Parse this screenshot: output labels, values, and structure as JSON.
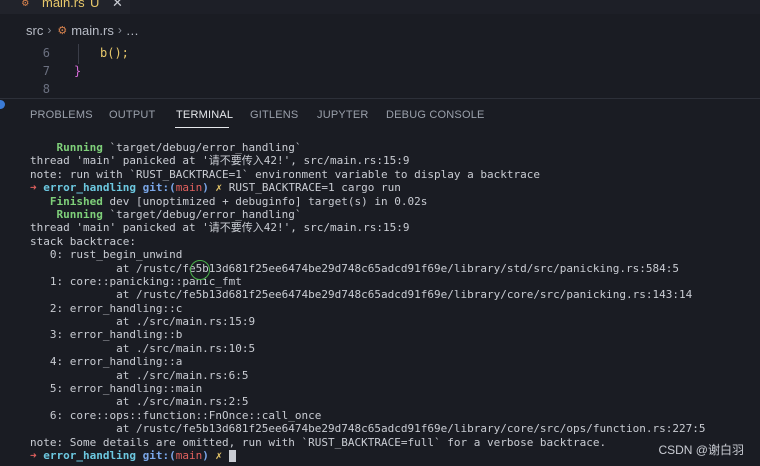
{
  "tab": {
    "label": "main.rs",
    "status": "U",
    "close": "✕"
  },
  "breadcrumb": {
    "folder": "src",
    "file": "main.rs",
    "symbol": "…"
  },
  "editor": {
    "lines": [
      {
        "num": "6",
        "code": "b();"
      },
      {
        "num": "7",
        "code": "}"
      },
      {
        "num": "8",
        "code": ""
      }
    ]
  },
  "panel": {
    "tabs": [
      "PROBLEMS",
      "OUTPUT",
      "TERMINAL",
      "GITLENS",
      "JUPYTER",
      "DEBUG CONSOLE"
    ],
    "active": "TERMINAL"
  },
  "terminal": {
    "run1_label": "Running",
    "run1_text": " `target/debug/error_handling`",
    "panic1": "thread 'main' panicked at '请不要传入42!', src/main.rs:15:9",
    "note1": "note: run with `RUST_BACKTRACE=1` environment variable to display a backtrace",
    "prompt_arrow": "➜",
    "prompt_dir": "error_handling",
    "prompt_git": "git:(",
    "prompt_branch": "main",
    "prompt_git_close": ")",
    "prompt_x": "✗",
    "command": "RUST_BACKTRACE=1 cargo run",
    "finished_label": "Finished",
    "finished_text": " dev [unoptimized + debuginfo] target(s) in 0.02s",
    "run2_label": "Running",
    "run2_text": " `target/debug/error_handling`",
    "panic2": "thread 'main' panicked at '请不要传入42!', src/main.rs:15:9",
    "bt_header": "stack backtrace:",
    "bt": [
      "   0: rust_begin_unwind",
      "             at /rustc/fe5b13d681f25ee6474be29d748c65adcd91f69e/library/std/src/panicking.rs:584:5",
      "   1: core::panicking::panic_fmt",
      "             at /rustc/fe5b13d681f25ee6474be29d748c65adcd91f69e/library/core/src/panicking.rs:143:14",
      "   2: error_handling::c",
      "             at ./src/main.rs:15:9",
      "   3: error_handling::b",
      "             at ./src/main.rs:10:5",
      "   4: error_handling::a",
      "             at ./src/main.rs:6:5",
      "   5: error_handling::main",
      "             at ./src/main.rs:2:5",
      "   6: core::ops::function::FnOnce::call_once",
      "             at /rustc/fe5b13d681f25ee6474be29d748c65adcd91f69e/library/core/src/ops/function.rs:227:5"
    ],
    "note2": "note: Some details are omitted, run with `RUST_BACKTRACE=full` for a verbose backtrace."
  },
  "watermark": "CSDN @谢白羽",
  "colors": {
    "background": "#1a1c23",
    "green": "#7fd07a",
    "red": "#e0605e",
    "cyan": "#6cc8e0",
    "blue": "#7aa6e8",
    "yellow": "#e8c86a"
  }
}
